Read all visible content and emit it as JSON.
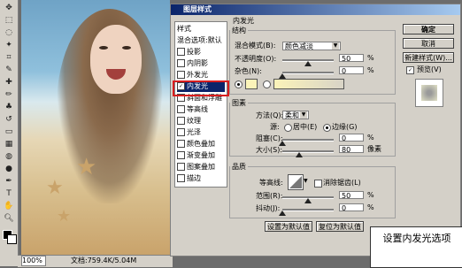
{
  "status": {
    "zoom": "100%",
    "doc": "文档:759.4K/5.04M"
  },
  "dialog": {
    "title": "图层样式",
    "style_list": [
      {
        "label": "样式",
        "checkable": false,
        "checked": false
      },
      {
        "label": "混合选项:默认",
        "checkable": false,
        "checked": false
      },
      {
        "label": "投影",
        "checkable": true,
        "checked": false
      },
      {
        "label": "内阴影",
        "checkable": true,
        "checked": false
      },
      {
        "label": "外发光",
        "checkable": true,
        "checked": false
      },
      {
        "label": "内发光",
        "checkable": true,
        "checked": true
      },
      {
        "label": "斜面和浮雕",
        "checkable": true,
        "checked": false
      },
      {
        "label": "等高线",
        "checkable": true,
        "checked": false
      },
      {
        "label": "纹理",
        "checkable": true,
        "checked": false
      },
      {
        "label": "光泽",
        "checkable": true,
        "checked": false
      },
      {
        "label": "颜色叠加",
        "checkable": true,
        "checked": false
      },
      {
        "label": "渐变叠加",
        "checkable": true,
        "checked": false
      },
      {
        "label": "图案叠加",
        "checkable": true,
        "checked": false
      },
      {
        "label": "描边",
        "checkable": true,
        "checked": false
      }
    ],
    "panel_title": "内发光",
    "structure": {
      "legend": "结构",
      "blend_label": "混合模式(B):",
      "blend_value": "颜色减淡",
      "opacity_label": "不透明度(O):",
      "opacity_value": "50",
      "opacity_level": 0.5,
      "noise_label": "杂色(N):",
      "noise_value": "0",
      "noise_level": 0,
      "unit": "%"
    },
    "elements": {
      "legend": "图素",
      "method_label": "方法(Q):",
      "method_value": "柔和",
      "source_label": "源:",
      "center_label": "居中(E)",
      "edge_label": "边缘(G)",
      "choke_label": "阻塞(C):",
      "choke_value": "0",
      "choke_level": 0,
      "size_label": "大小(S):",
      "size_value": "80",
      "size_level": 0.32,
      "pct_unit": "%",
      "px_unit": "像素"
    },
    "quality": {
      "legend": "品质",
      "contour_label": "等高线:",
      "antialias_label": "消除锯齿(L)",
      "range_label": "范围(R):",
      "range_value": "50",
      "range_level": 0.5,
      "jitter_label": "抖动(J):",
      "jitter_value": "0",
      "jitter_level": 0,
      "unit": "%"
    },
    "buttons": {
      "ok": "确定",
      "cancel": "取消",
      "new_style": "新建样式(W)...",
      "preview": "预览(V)",
      "set_default": "设置为默认值",
      "reset_default": "复位为默认值"
    }
  },
  "caption": "设置内发光选项"
}
